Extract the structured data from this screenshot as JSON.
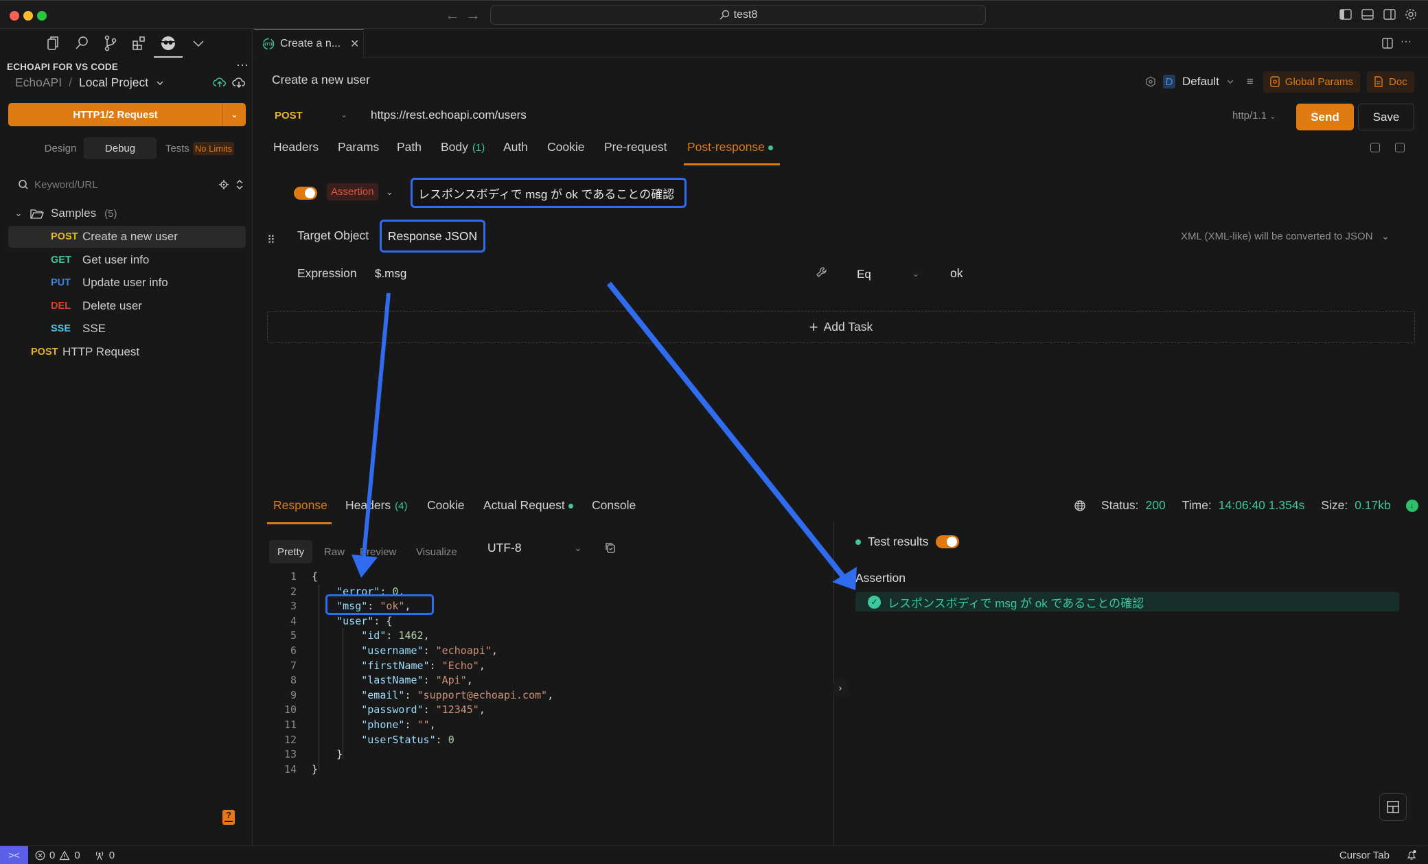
{
  "window": {
    "command_center_text": "test8",
    "nav_back": "←",
    "nav_forward": "→"
  },
  "sidebar": {
    "title": "ECHOAPI FOR VS CODE",
    "more": "···",
    "breadcrumb": {
      "root": "EchoAPI",
      "separator": "/",
      "project": "Local Project"
    },
    "new_request_label": "HTTP1/2 Request",
    "mode_tabs": [
      {
        "label": "Design",
        "active": false
      },
      {
        "label": "Debug",
        "active": true
      },
      {
        "label": "Tests",
        "badge": "No Limits",
        "active": false
      }
    ],
    "search_placeholder": "Keyword/URL",
    "folder": {
      "name": "Samples",
      "count": "(5)"
    },
    "items": [
      {
        "method": "POST",
        "label": "Create a new user",
        "active": true,
        "color": "#e8b42c"
      },
      {
        "method": "GET",
        "label": "Get user info",
        "active": false,
        "color": "#3fc79c"
      },
      {
        "method": "PUT",
        "label": "Update user info",
        "active": false,
        "color": "#3b82e6"
      },
      {
        "method": "DEL",
        "label": "Delete user",
        "active": false,
        "color": "#e5392b"
      },
      {
        "method": "SSE",
        "label": "SSE",
        "active": false,
        "color": "#4cc3e8"
      }
    ],
    "root_item": {
      "method": "POST",
      "label": "HTTP Request",
      "color": "#e8b42c"
    }
  },
  "editor_tab": {
    "label": "Create a n...",
    "icon_text": "HTTP"
  },
  "request": {
    "title": "Create a new user",
    "environment": {
      "badge": "D",
      "name": "Default"
    },
    "global_params_label": "Global Params",
    "doc_label": "Doc",
    "method": "POST",
    "url": "https://rest.echoapi.com/users",
    "http_version": "http/1.1",
    "send_label": "Send",
    "save_label": "Save",
    "tabs": [
      {
        "label": "Headers"
      },
      {
        "label": "Params"
      },
      {
        "label": "Path"
      },
      {
        "label": "Body",
        "count": "(1)"
      },
      {
        "label": "Auth"
      },
      {
        "label": "Cookie"
      },
      {
        "label": "Pre-request"
      },
      {
        "label": "Post-response",
        "active": true,
        "dot": true
      }
    ]
  },
  "assertion": {
    "enabled": true,
    "type": "Assertion",
    "name": "レスポンスボディで msg が ok であることの確認",
    "target_label": "Target Object",
    "target_value": "Response JSON",
    "xml_note": "XML (XML-like) will be converted to JSON",
    "expression_label": "Expression",
    "expression_value": "$.msg",
    "operator": "Eq",
    "expected": "ok",
    "add_task_label": "Add Task"
  },
  "response": {
    "tabs": [
      {
        "label": "Response",
        "active": true
      },
      {
        "label": "Headers",
        "count": "(4)"
      },
      {
        "label": "Cookie"
      },
      {
        "label": "Actual Request",
        "dot": true
      },
      {
        "label": "Console"
      }
    ],
    "status_label": "Status:",
    "status_value": "200",
    "time_label": "Time:",
    "time_value": "14:06:40 1.354s",
    "size_label": "Size:",
    "size_value": "0.17kb",
    "view_tabs": [
      {
        "label": "Pretty",
        "active": true
      },
      {
        "label": "Raw"
      },
      {
        "label": "Preview"
      },
      {
        "label": "Visualize"
      }
    ],
    "encoding": "UTF-8",
    "code_lines": [
      "{",
      "    \"error\": 0,",
      "    \"msg\": \"ok\",",
      "    \"user\": {",
      "        \"id\": 1462,",
      "        \"username\": \"echoapi\",",
      "        \"firstName\": \"Echo\",",
      "        \"lastName\": \"Api\",",
      "        \"email\": \"support@echoapi.com\",",
      "        \"password\": \"12345\",",
      "        \"phone\": \"\",",
      "        \"userStatus\": 0",
      "    }",
      "}"
    ],
    "test_results_label": "Test results",
    "test_results_enabled": true,
    "result_heading": "Assertion",
    "result_item": "レスポンスボディで msg が ok であることの確認",
    "result_passed": true
  },
  "statusbar": {
    "errors": "0",
    "warnings": "0",
    "ports": "0",
    "cursor_tab": "Cursor Tab"
  },
  "colors": {
    "accent": "#e07a12",
    "success": "#3fc79c",
    "annotation": "#2f6cf0"
  }
}
